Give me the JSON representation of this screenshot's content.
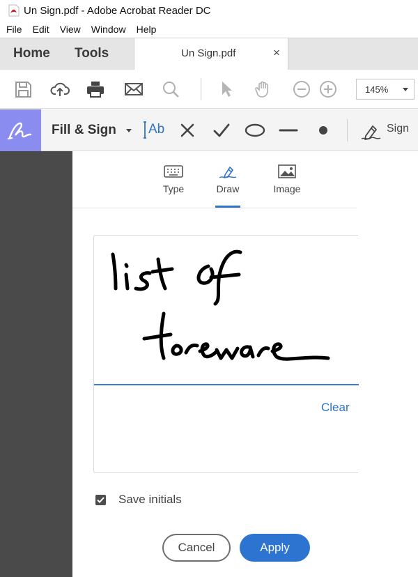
{
  "window": {
    "title": "Un Sign.pdf - Adobe Acrobat Reader DC",
    "icon": "pdf-file-icon"
  },
  "menu": {
    "items": [
      "File",
      "Edit",
      "View",
      "Window",
      "Help"
    ]
  },
  "tabs": {
    "home": "Home",
    "tools": "Tools",
    "document": "Un Sign.pdf",
    "close_glyph": "×"
  },
  "toolbar": {
    "icons": [
      "save-icon",
      "cloud-upload-icon",
      "print-icon",
      "email-icon",
      "search-icon",
      "select-arrow-icon",
      "hand-icon",
      "zoom-out-icon",
      "zoom-in-icon"
    ],
    "zoom_value": "145%"
  },
  "fill_sign": {
    "label": "Fill & Sign",
    "text_tool": "Ab",
    "tools": [
      "text-ab-icon",
      "cross-icon",
      "checkmark-icon",
      "ellipse-icon",
      "line-icon",
      "dot-icon"
    ],
    "sign_label": "Sign",
    "accent": "#8b8cf0"
  },
  "dialog": {
    "tabs": [
      {
        "label": "Type",
        "icon": "keyboard-icon"
      },
      {
        "label": "Draw",
        "icon": "pen-draw-icon"
      },
      {
        "label": "Image",
        "icon": "image-icon"
      }
    ],
    "active_tab": "Draw",
    "clear_label": "Clear",
    "save_initials_label": "Save initials",
    "save_initials_checked": true,
    "cancel_label": "Cancel",
    "apply_label": "Apply",
    "accent": "#2d74d0"
  }
}
